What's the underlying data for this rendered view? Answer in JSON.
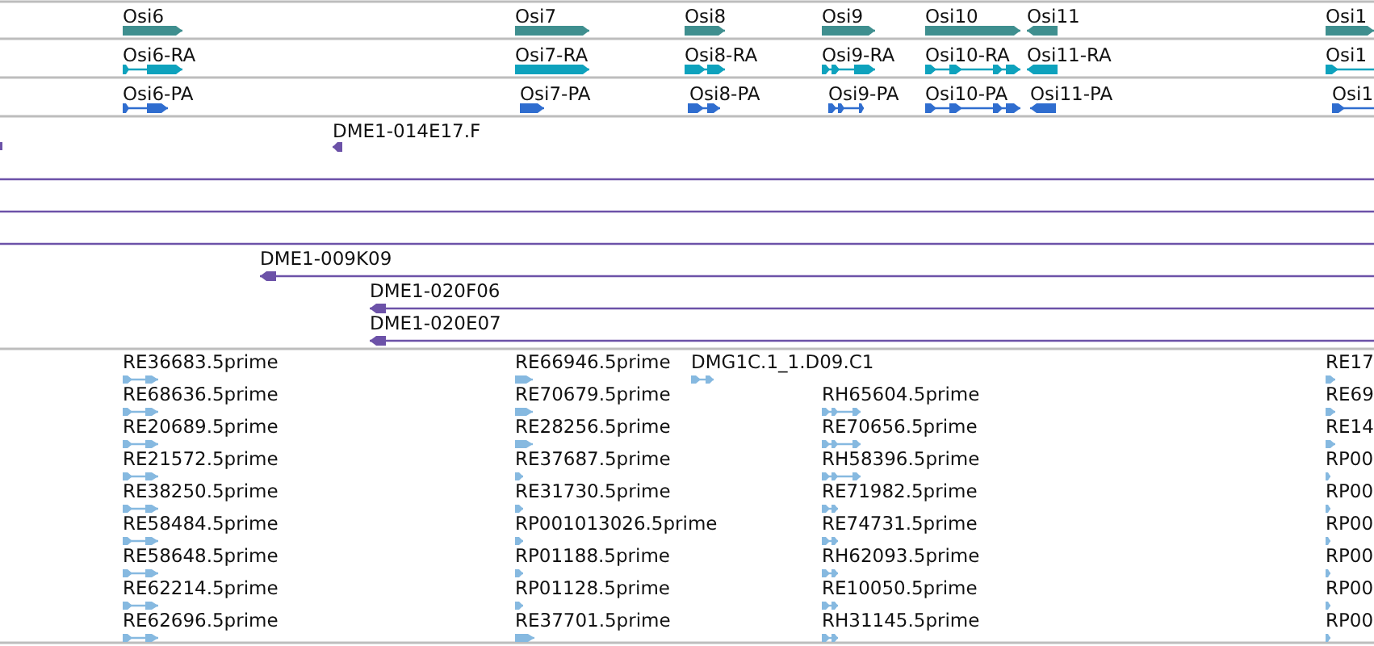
{
  "tracks": [
    {
      "kind": "gene",
      "color": "#3f8f8f",
      "features": [
        {
          "label": "Osi6",
          "reverse": false
        },
        {
          "label": "Osi7",
          "reverse": false
        },
        {
          "label": "Osi8",
          "reverse": false
        },
        {
          "label": "Osi9",
          "reverse": false
        },
        {
          "label": "Osi10",
          "reverse": false
        },
        {
          "label": "Osi11",
          "reverse": true
        },
        {
          "label": "Osi1",
          "reverse": false
        }
      ]
    },
    {
      "kind": "transcript",
      "color": "#0ea2bd",
      "features": [
        {
          "label": "Osi6-RA",
          "reverse": false
        },
        {
          "label": "Osi7-RA",
          "reverse": false
        },
        {
          "label": "Osi8-RA",
          "reverse": false
        },
        {
          "label": "Osi9-RA",
          "reverse": false
        },
        {
          "label": "Osi10-RA",
          "reverse": false
        },
        {
          "label": "Osi11-RA",
          "reverse": true
        },
        {
          "label": "Osi1",
          "reverse": false
        }
      ]
    },
    {
      "kind": "protein",
      "color": "#2f6dcf",
      "features": [
        {
          "label": "Osi6-PA",
          "reverse": false
        },
        {
          "label": "Osi7-PA",
          "reverse": false
        },
        {
          "label": "Osi8-PA",
          "reverse": false
        },
        {
          "label": "Osi9-PA",
          "reverse": false
        },
        {
          "label": "Osi10-PA",
          "reverse": false
        },
        {
          "label": "Osi11-PA",
          "reverse": true
        },
        {
          "label": "Osi1",
          "reverse": false
        }
      ]
    },
    {
      "kind": "clone",
      "color": "#6c52a8",
      "features": [
        {
          "label": "DME1-014E17.F",
          "reverse": true
        },
        {
          "label": "DME1-009K09",
          "reverse": true
        },
        {
          "label": "DME1-020F06",
          "reverse": true
        },
        {
          "label": "DME1-020E07",
          "reverse": true
        }
      ]
    },
    {
      "kind": "est",
      "color": "#86b9e0",
      "features": [
        {
          "label": "RE36683.5prime",
          "reverse": false
        },
        {
          "label": "RE68636.5prime",
          "reverse": false
        },
        {
          "label": "RE20689.5prime",
          "reverse": false
        },
        {
          "label": "RE21572.5prime",
          "reverse": false
        },
        {
          "label": "RE38250.5prime",
          "reverse": false
        },
        {
          "label": "RE58484.5prime",
          "reverse": false
        },
        {
          "label": "RE58648.5prime",
          "reverse": false
        },
        {
          "label": "RE62214.5prime",
          "reverse": false
        },
        {
          "label": "RE62696.5prime",
          "reverse": false
        },
        {
          "label": "RE66946.5prime",
          "reverse": false
        },
        {
          "label": "RE70679.5prime",
          "reverse": false
        },
        {
          "label": "RE28256.5prime",
          "reverse": false
        },
        {
          "label": "RE37687.5prime",
          "reverse": false
        },
        {
          "label": "RE31730.5prime",
          "reverse": false
        },
        {
          "label": "RP001013026.5prime",
          "reverse": false
        },
        {
          "label": "RP01188.5prime",
          "reverse": false
        },
        {
          "label": "RP01128.5prime",
          "reverse": false
        },
        {
          "label": "RE37701.5prime",
          "reverse": false
        },
        {
          "label": "DMG1C.1_1.D09.C1",
          "reverse": false
        },
        {
          "label": "RH65604.5prime",
          "reverse": false
        },
        {
          "label": "RE70656.5prime",
          "reverse": false
        },
        {
          "label": "RH58396.5prime",
          "reverse": false
        },
        {
          "label": "RE71982.5prime",
          "reverse": false
        },
        {
          "label": "RE74731.5prime",
          "reverse": false
        },
        {
          "label": "RH62093.5prime",
          "reverse": false
        },
        {
          "label": "RE10050.5prime",
          "reverse": false
        },
        {
          "label": "RH31145.5prime",
          "reverse": false
        },
        {
          "label": "RE17",
          "reverse": false
        },
        {
          "label": "RE69",
          "reverse": false
        },
        {
          "label": "RE14",
          "reverse": false
        },
        {
          "label": "RP00",
          "reverse": false
        },
        {
          "label": "RP00",
          "reverse": false
        },
        {
          "label": "RP00",
          "reverse": false
        },
        {
          "label": "RP00",
          "reverse": false
        },
        {
          "label": "RP00",
          "reverse": false
        },
        {
          "label": "RP00",
          "reverse": false
        }
      ]
    }
  ]
}
